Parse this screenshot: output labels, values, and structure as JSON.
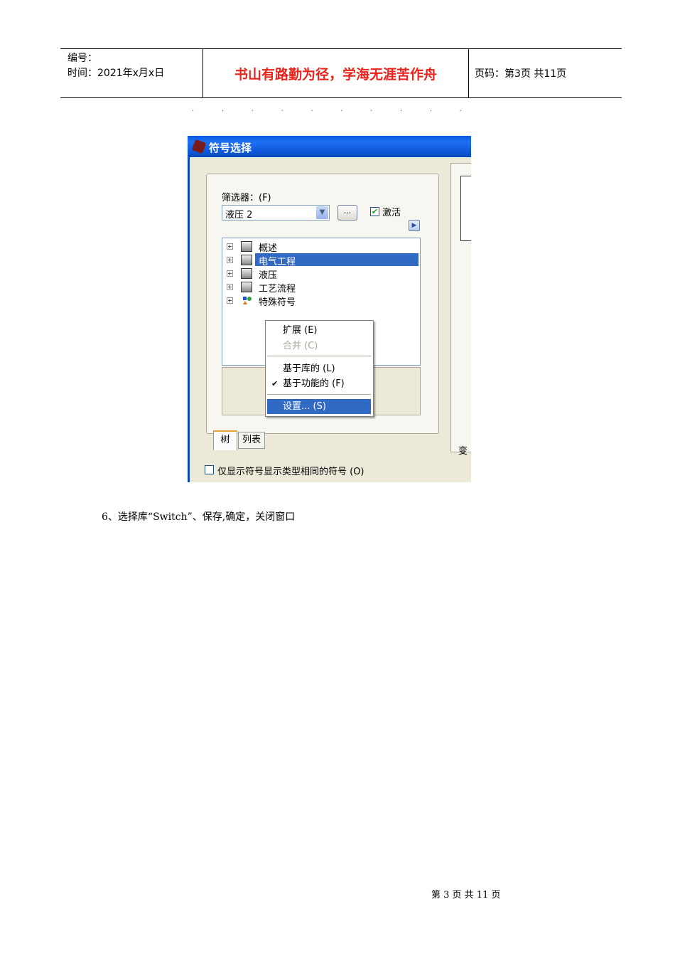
{
  "header": {
    "serial_label": "编号：",
    "date_label": "时间：2021年x月x日",
    "motto": "书山有路勤为径，学海无涯苦作舟",
    "page_label": "页码：第3页  共11页"
  },
  "dialog": {
    "title": "符号选择",
    "filter_label": "筛选器：(F)",
    "filter_value": "液压 2",
    "more_button": "...",
    "activate_label": "激活",
    "tree_items": [
      "概述",
      "电气工程",
      "液压",
      "工艺流程",
      "特殊符号"
    ],
    "tabs": [
      "树",
      "列表"
    ],
    "only_same_type_label": "仅显示符号显示类型相同的符号 (O)",
    "right_label": "变"
  },
  "context_menu": {
    "items": [
      {
        "label": "扩展 (E)"
      },
      {
        "label": "合并 (C)"
      },
      {
        "label": "基于库的 (L)"
      },
      {
        "label": "基于功能的 (F)"
      },
      {
        "label": "设置... (S)"
      }
    ]
  },
  "body": {
    "step6": "6、选择库“Switch”、保存,确定，关闭窗口"
  },
  "footer": {
    "page": "第 3 页 共 11 页"
  },
  "colors": {
    "motto": "#e8231b",
    "title_bar": "#0a5bde",
    "selection": "#316ac5"
  }
}
